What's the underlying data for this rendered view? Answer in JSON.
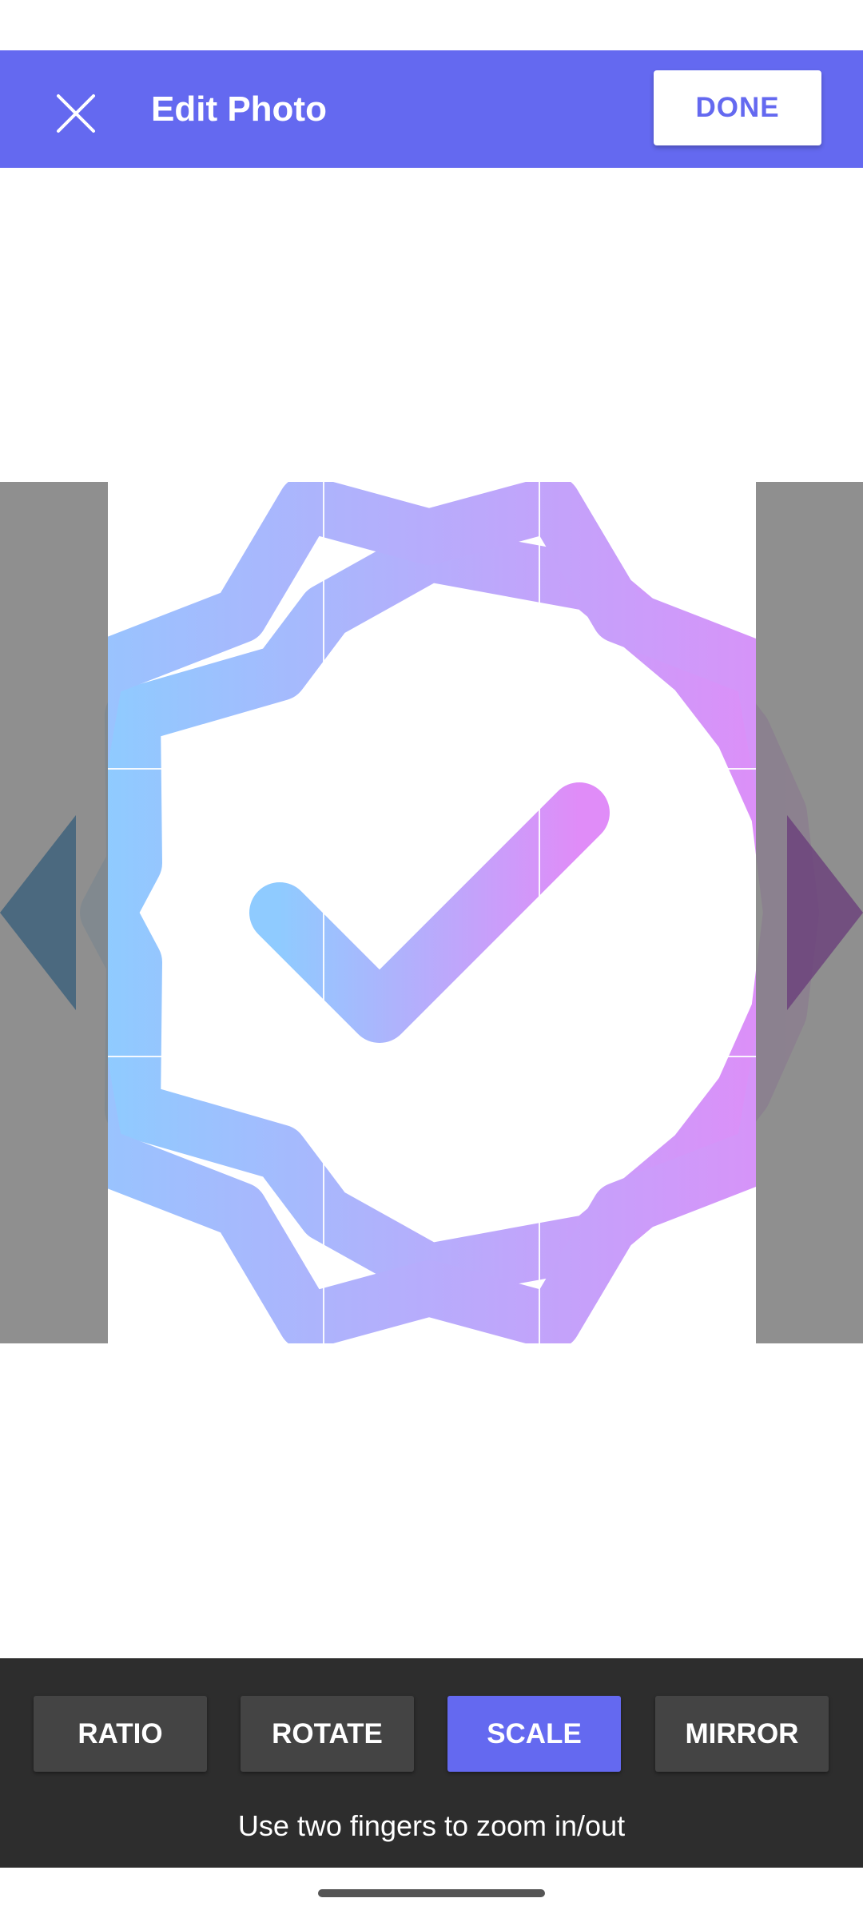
{
  "app_bar": {
    "title": "Edit Photo",
    "close_icon": "close-icon",
    "done_label": "DONE",
    "background": "#6469F0"
  },
  "image": {
    "icon": "verified-badge-checkmark",
    "gradient_start": "#8FCBFF",
    "gradient_end": "#E08CF8",
    "crop_overlay": "#808080"
  },
  "toolbar": {
    "buttons": [
      {
        "label": "RATIO",
        "active": false
      },
      {
        "label": "ROTATE",
        "active": false
      },
      {
        "label": "SCALE",
        "active": true
      },
      {
        "label": "MIRROR",
        "active": false
      }
    ],
    "hint": "Use two fingers to zoom in/out",
    "active_color": "#6469F0"
  }
}
